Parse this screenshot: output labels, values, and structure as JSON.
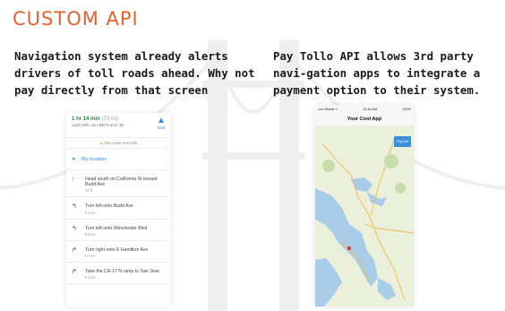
{
  "title": "CUSTOM API",
  "left_text": "Navigation system already alerts drivers of toll roads ahead. Why not pay directly from that screen",
  "right_text": "Pay Tollo API allows 3rd party navi-gation apps to integrate a payment option to their system.",
  "nav_screen": {
    "eta": "1 hr 14 min",
    "eta_distance": "(73 mi)",
    "traffic": "Light traffic via I-880 N and I-80",
    "start_label": "Start",
    "toll_notice": "This route has tolls.",
    "my_location": "My location",
    "steps": [
      {
        "icon": "straight-arrow-icon",
        "glyph": "↑",
        "text": "Head south on California St toward Budd Ave",
        "dist": "10 ft"
      },
      {
        "icon": "turn-left-icon",
        "glyph": "↰",
        "text": "Turn left onto Budd Ave",
        "dist": "0.2 mi"
      },
      {
        "icon": "turn-left-icon",
        "glyph": "↰",
        "text": "Turn left onto Winchester Blvd",
        "dist": "0.8 mi"
      },
      {
        "icon": "turn-right-icon",
        "glyph": "↱",
        "text": "Turn right onto E Hamilton Ave",
        "dist": "0.7 mi"
      },
      {
        "icon": "ramp-right-icon",
        "glyph": "↱",
        "text": "Take the CA-17 N ramp to San Jose",
        "dist": "0.2 mi"
      }
    ]
  },
  "map_screen": {
    "status_left": "••••• Mobile ≈",
    "status_center": "12:46 AM",
    "status_right": "100%",
    "app_title": "Your Cool App",
    "pay_button": "PayToll"
  },
  "colors": {
    "title": "#e8612c",
    "nav_blue": "#4285f4",
    "eta_green": "#1e8e3e",
    "water": "#a9cce8",
    "land": "#eaf0da",
    "pay_button": "#3b8fd9"
  }
}
